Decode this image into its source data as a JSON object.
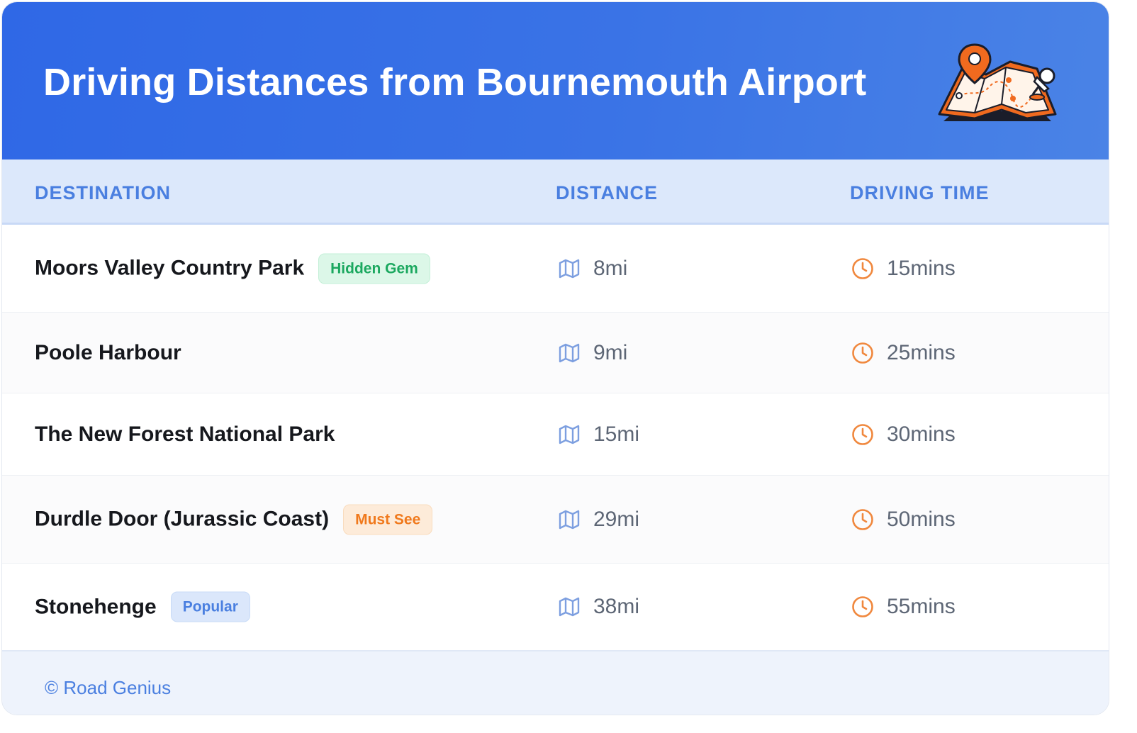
{
  "header": {
    "title": "Driving Distances from Bournemouth Airport",
    "illustration_icon": "map-with-pins-illustration"
  },
  "table": {
    "columns": [
      "DESTINATION",
      "DISTANCE",
      "DRIVING TIME"
    ],
    "rows": [
      {
        "destination": "Moors Valley Country Park",
        "badge": "Hidden Gem",
        "badge_color": "#1ba85f",
        "distance": "8mi",
        "time": "15mins"
      },
      {
        "destination": "Poole Harbour",
        "badge": "",
        "badge_color": "",
        "distance": "9mi",
        "time": "25mins"
      },
      {
        "destination": "The New Forest National Park",
        "badge": "",
        "badge_color": "",
        "distance": "15mi",
        "time": "30mins"
      },
      {
        "destination": "Durdle Door (Jurassic Coast)",
        "badge": "Must See",
        "badge_color": "#f0791c",
        "distance": "29mi",
        "time": "50mins"
      },
      {
        "destination": "Stonehenge",
        "badge": "Popular",
        "badge_color": "#4a7fe0",
        "distance": "38mi",
        "time": "55mins"
      }
    ],
    "distance_icon": "map-icon",
    "time_icon": "clock-icon"
  },
  "footer": {
    "credit": "© Road Genius"
  },
  "colors": {
    "header_blue": "#2f68e6",
    "accent_blue": "#4a7fe0",
    "clock_orange": "#f0883e",
    "map_icon_blue": "#7d9fe0"
  }
}
